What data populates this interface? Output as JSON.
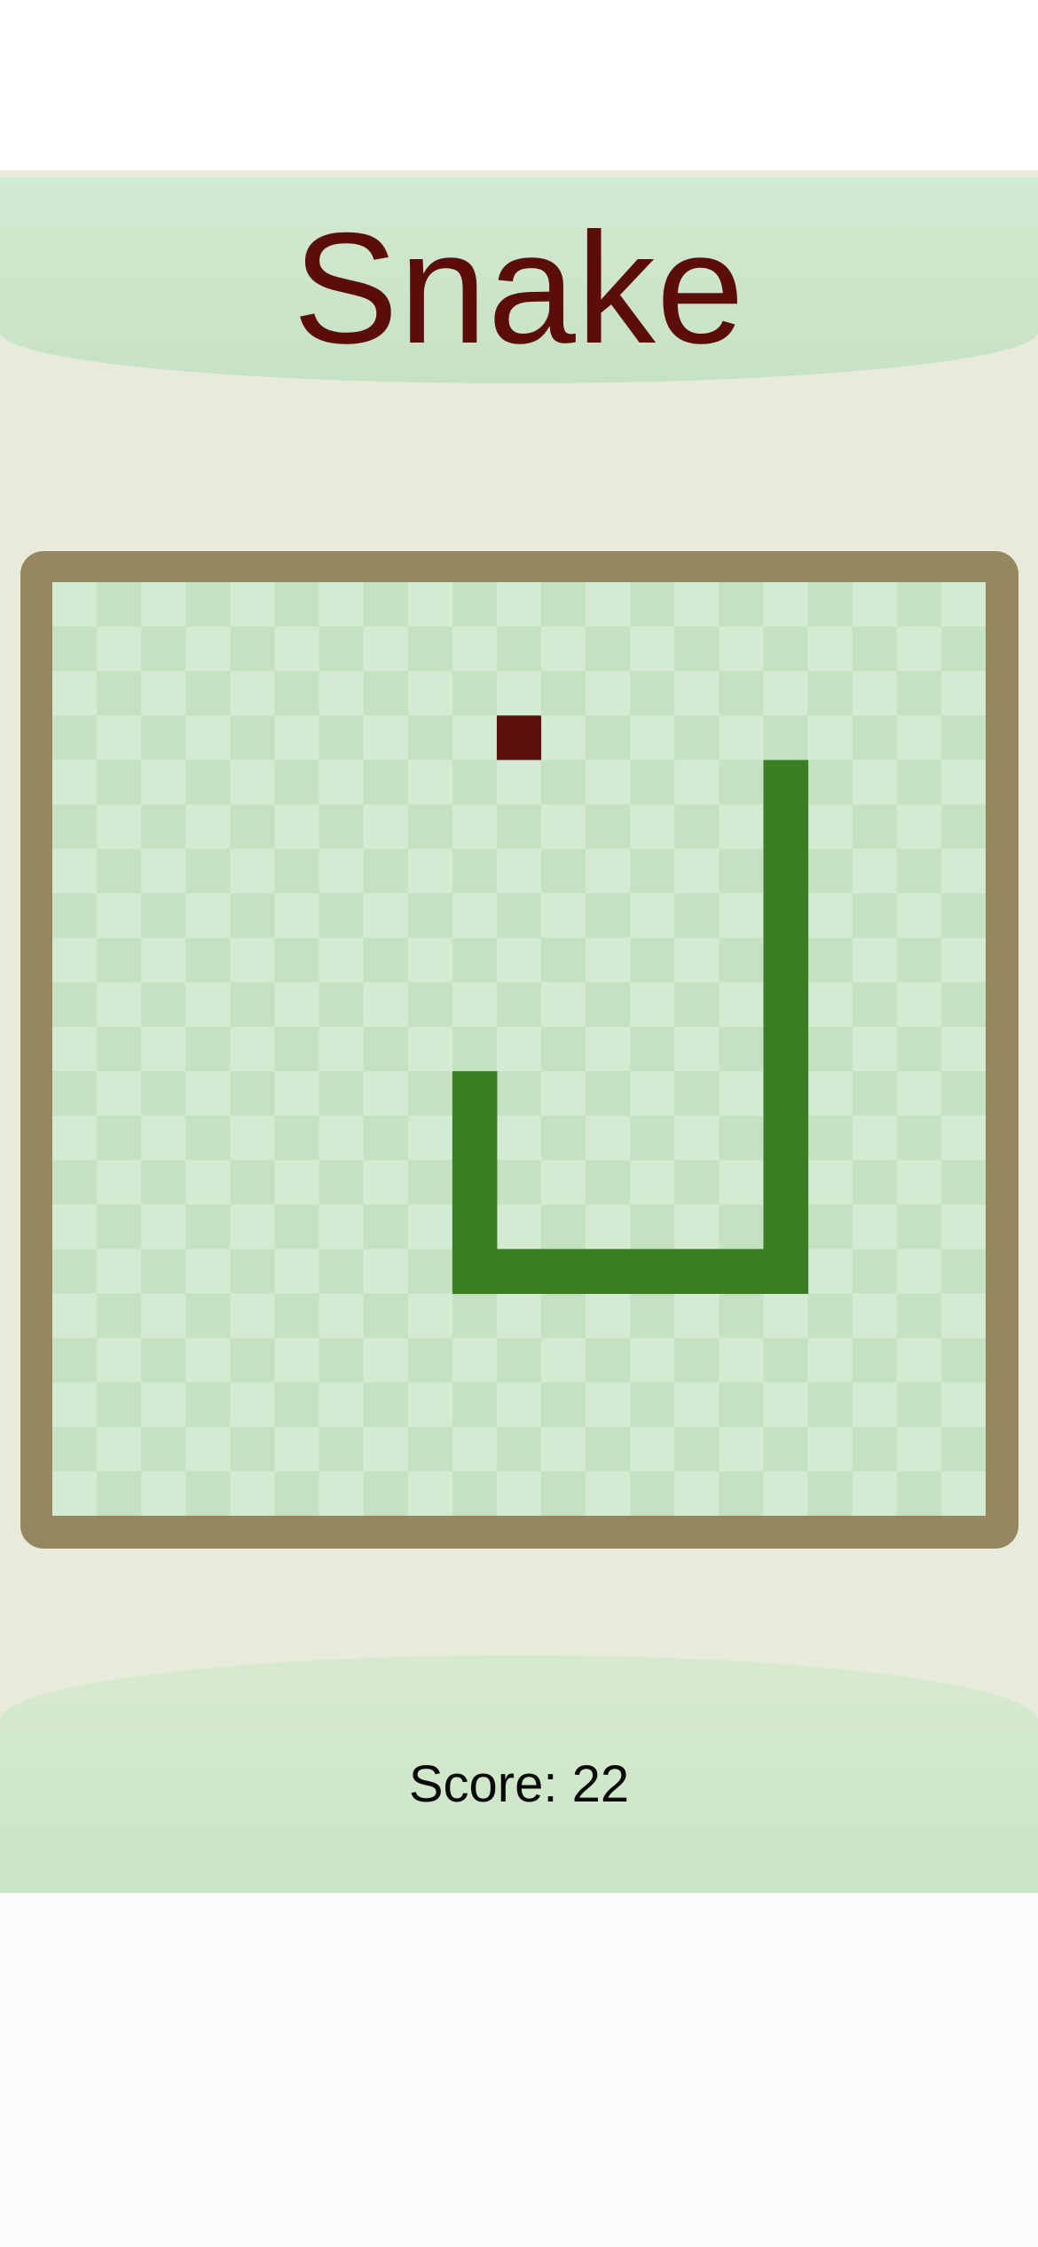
{
  "title": "Snake",
  "score_label": "Score: 22",
  "colors": {
    "background": "#e8eadc",
    "header": "#cfe6cd",
    "title_text": "#5b0e09",
    "board_border": "#968760",
    "tile_light": "#d4ead3",
    "tile_dark": "#c4e2c2",
    "snake": "#3a7f23",
    "food": "#5a0f0a"
  },
  "grid": {
    "cols": 21,
    "rows": 21
  },
  "snake": {
    "segments": [
      [
        9,
        11
      ],
      [
        9,
        12
      ],
      [
        9,
        13
      ],
      [
        9,
        14
      ],
      [
        9,
        15
      ],
      [
        10,
        15
      ],
      [
        11,
        15
      ],
      [
        12,
        15
      ],
      [
        13,
        15
      ],
      [
        14,
        15
      ],
      [
        15,
        15
      ],
      [
        16,
        15
      ],
      [
        16,
        14
      ],
      [
        16,
        13
      ],
      [
        16,
        12
      ],
      [
        16,
        11
      ],
      [
        16,
        10
      ],
      [
        16,
        9
      ],
      [
        16,
        8
      ],
      [
        16,
        7
      ],
      [
        16,
        6
      ],
      [
        16,
        4
      ],
      [
        16,
        5
      ]
    ]
  },
  "food": {
    "cell": [
      10,
      3
    ],
    "icon": "apple-square"
  }
}
